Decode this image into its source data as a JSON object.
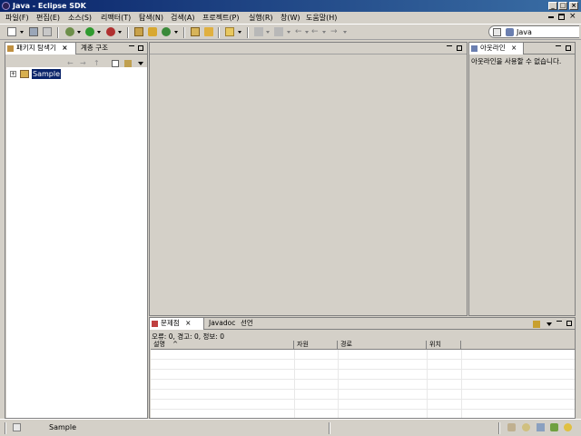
{
  "window": {
    "title": "Java - Eclipse SDK",
    "minimize_glyph": "_",
    "maximize_glyph": "□",
    "close_glyph": "×"
  },
  "menu": [
    "파일(F)",
    "편집(E)",
    "소스(S)",
    "리팩터(T)",
    "탐색(N)",
    "검색(A)",
    "프로젝트(P)",
    "실행(R)",
    "창(W)",
    "도움말(H)"
  ],
  "perspective": {
    "label": "Java"
  },
  "explorer": {
    "tabs": [
      "패키지 탐색기",
      "계층 구조"
    ],
    "close_glyph": "×",
    "project": {
      "name": "Sample",
      "expander": "+"
    }
  },
  "outline": {
    "tab": "아웃라인",
    "close_glyph": "×",
    "message": "아웃라인을 사용할 수 없습니다."
  },
  "bottom": {
    "tabs": [
      "문제점",
      "Javadoc",
      "선언"
    ],
    "close_glyph": "×",
    "summary": "오류: 0, 경고: 0, 정보: 0",
    "columns": [
      "설명",
      "자원",
      "경로",
      "위치"
    ],
    "sort_glyph": "^"
  },
  "status": {
    "text": "Sample"
  },
  "colors": {
    "selection": "#0a246a",
    "title_start": "#0a246a",
    "title_end": "#3a6ea5",
    "chrome": "#d4d0c8"
  }
}
